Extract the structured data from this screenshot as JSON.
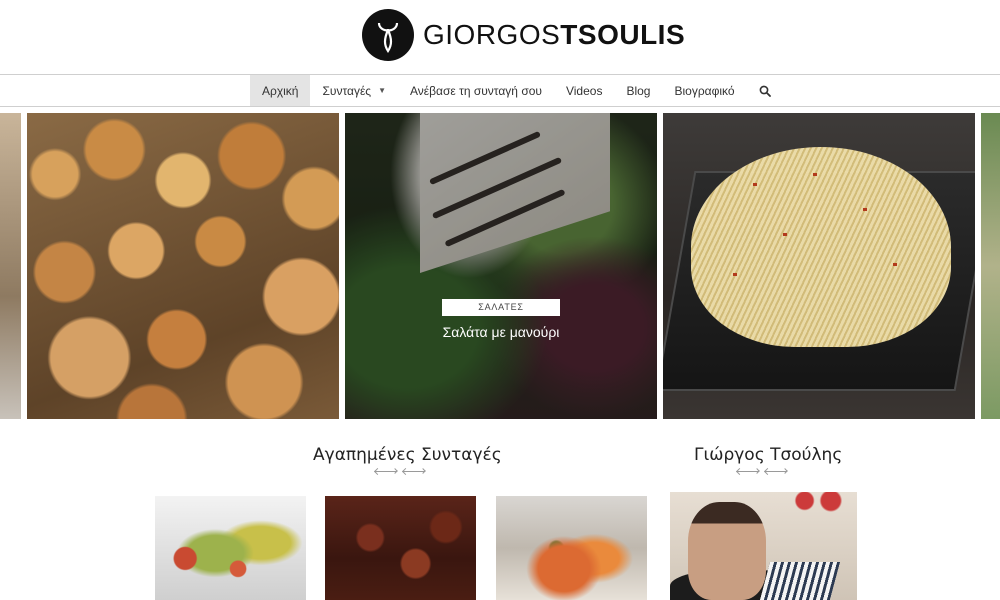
{
  "logo": {
    "name_light": "GIORGOS",
    "name_bold": "TSOULIS"
  },
  "nav": {
    "items": [
      {
        "label": "Αρχική",
        "active": true
      },
      {
        "label": "Συνταγές",
        "has_dropdown": true
      },
      {
        "label": "Ανέβασε τη συνταγή σου"
      },
      {
        "label": "Videos"
      },
      {
        "label": "Blog"
      },
      {
        "label": "Βιογραφικό"
      }
    ],
    "search_icon": "search-icon",
    "dropdown_icon": "▼"
  },
  "slider": {
    "featured": {
      "category": "ΣΑΛΑΤΕΣ",
      "title": "Σαλάτα με μανούρι"
    }
  },
  "sections": {
    "favorites_title": "Αγαπημένες Συνταγές",
    "about_title": "Γιώργος Τσούλης"
  },
  "colors": {
    "accent": "#111111",
    "nav_active_bg": "#e4e4e4",
    "divider": "#9a9a9a"
  }
}
